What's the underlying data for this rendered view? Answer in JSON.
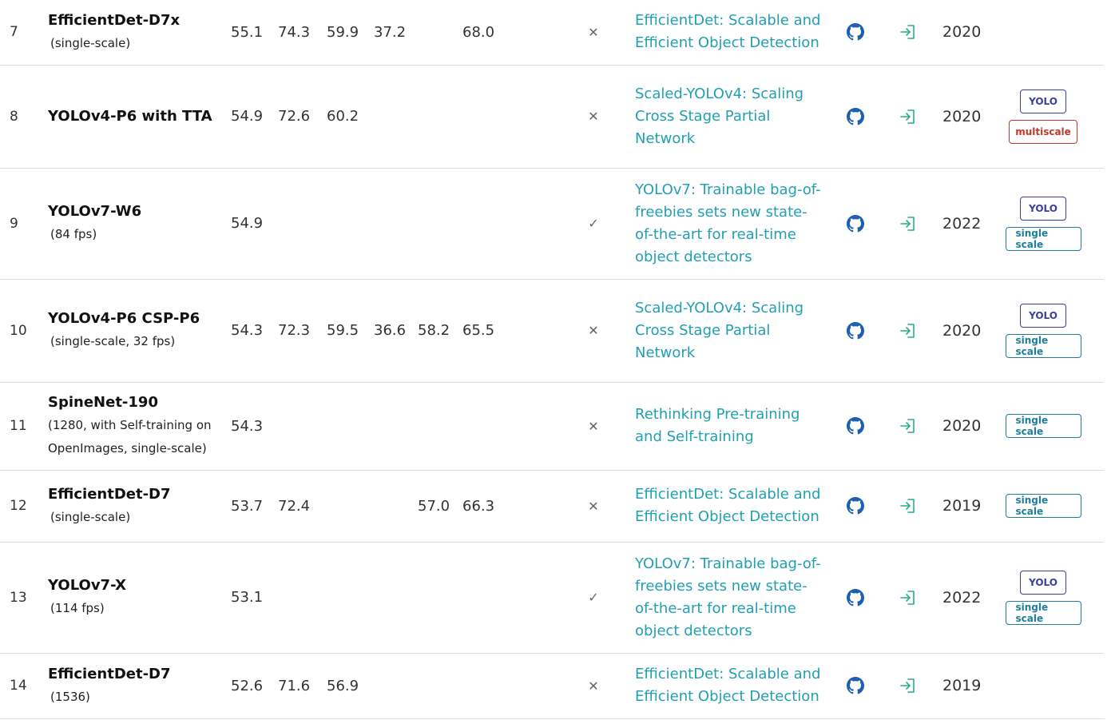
{
  "colors": {
    "link": "#21a0b3",
    "code_icon": "#1f5fb0",
    "result_icon": "#2ab07d",
    "yolo_tag": "#3b3fa0",
    "multiscale_tag": "#c0392b",
    "single_scale_tag": "#1f7e9b",
    "divider": "#dcdcdc"
  },
  "rows": [
    {
      "rank": "7",
      "model": "EfficientDet-D7x",
      "detail": "(single-scale)",
      "metrics": [
        "55.1",
        "74.3",
        "59.9",
        "37.2",
        "",
        "68.0"
      ],
      "extra_training": "✕",
      "paper": "EfficientDet: Scalable and Efficient Object Detection",
      "code_icon": "github-icon",
      "result_icon": "enter-icon",
      "year": "2020",
      "tags": []
    },
    {
      "rank": "8",
      "model": "YOLOv4-P6 with TTA",
      "detail": "",
      "metrics": [
        "54.9",
        "72.6",
        "60.2",
        "",
        "",
        ""
      ],
      "extra_training": "✕",
      "paper": "Scaled-YOLOv4: Scaling Cross Stage Partial Network",
      "code_icon": "github-icon",
      "result_icon": "enter-icon",
      "year": "2020",
      "tags": [
        "YOLO",
        "multiscale"
      ]
    },
    {
      "rank": "9",
      "model": "YOLOv7-W6",
      "detail": "(84 fps)",
      "metrics": [
        "54.9",
        "",
        "",
        "",
        "",
        ""
      ],
      "extra_training": "✓",
      "paper": "YOLOv7: Trainable bag-of-freebies sets new state-of-the-art for real-time object detectors",
      "code_icon": "github-icon",
      "result_icon": "enter-icon",
      "year": "2022",
      "tags": [
        "YOLO",
        "single scale"
      ]
    },
    {
      "rank": "10",
      "model": "YOLOv4-P6 CSP-P6",
      "detail": "(single-scale, 32 fps)",
      "metrics": [
        "54.3",
        "72.3",
        "59.5",
        "36.6",
        "58.2",
        "65.5"
      ],
      "extra_training": "✕",
      "paper": "Scaled-YOLOv4: Scaling Cross Stage Partial Network",
      "code_icon": "github-icon",
      "result_icon": "enter-icon",
      "year": "2020",
      "tags": [
        "YOLO",
        "single scale"
      ]
    },
    {
      "rank": "11",
      "model": "SpineNet-190",
      "detail": "(1280, with Self-training on OpenImages, single-scale)",
      "metrics": [
        "54.3",
        "",
        "",
        "",
        "",
        ""
      ],
      "extra_training": "✕",
      "paper": "Rethinking Pre-training and Self-training",
      "code_icon": "github-icon",
      "result_icon": "enter-icon",
      "year": "2020",
      "tags": [
        "single scale"
      ]
    },
    {
      "rank": "12",
      "model": "EfficientDet-D7",
      "detail": "(single-scale)",
      "metrics": [
        "53.7",
        "72.4",
        "",
        "",
        "57.0",
        "66.3"
      ],
      "extra_training": "✕",
      "paper": "EfficientDet: Scalable and Efficient Object Detection",
      "code_icon": "github-icon",
      "result_icon": "enter-icon",
      "year": "2019",
      "tags": [
        "single scale"
      ]
    },
    {
      "rank": "13",
      "model": "YOLOv7-X",
      "detail": "(114 fps)",
      "metrics": [
        "53.1",
        "",
        "",
        "",
        "",
        ""
      ],
      "extra_training": "✓",
      "paper": "YOLOv7: Trainable bag-of-freebies sets new state-of-the-art for real-time object detectors",
      "code_icon": "github-icon",
      "result_icon": "enter-icon",
      "year": "2022",
      "tags": [
        "YOLO",
        "single scale"
      ]
    },
    {
      "rank": "14",
      "model": "EfficientDet-D7",
      "detail": "(1536)",
      "metrics": [
        "52.6",
        "71.6",
        "56.9",
        "",
        "",
        ""
      ],
      "extra_training": "✕",
      "paper": "EfficientDet: Scalable and Efficient Object Detection",
      "code_icon": "github-icon",
      "result_icon": "enter-icon",
      "year": "2019",
      "tags": []
    }
  ]
}
